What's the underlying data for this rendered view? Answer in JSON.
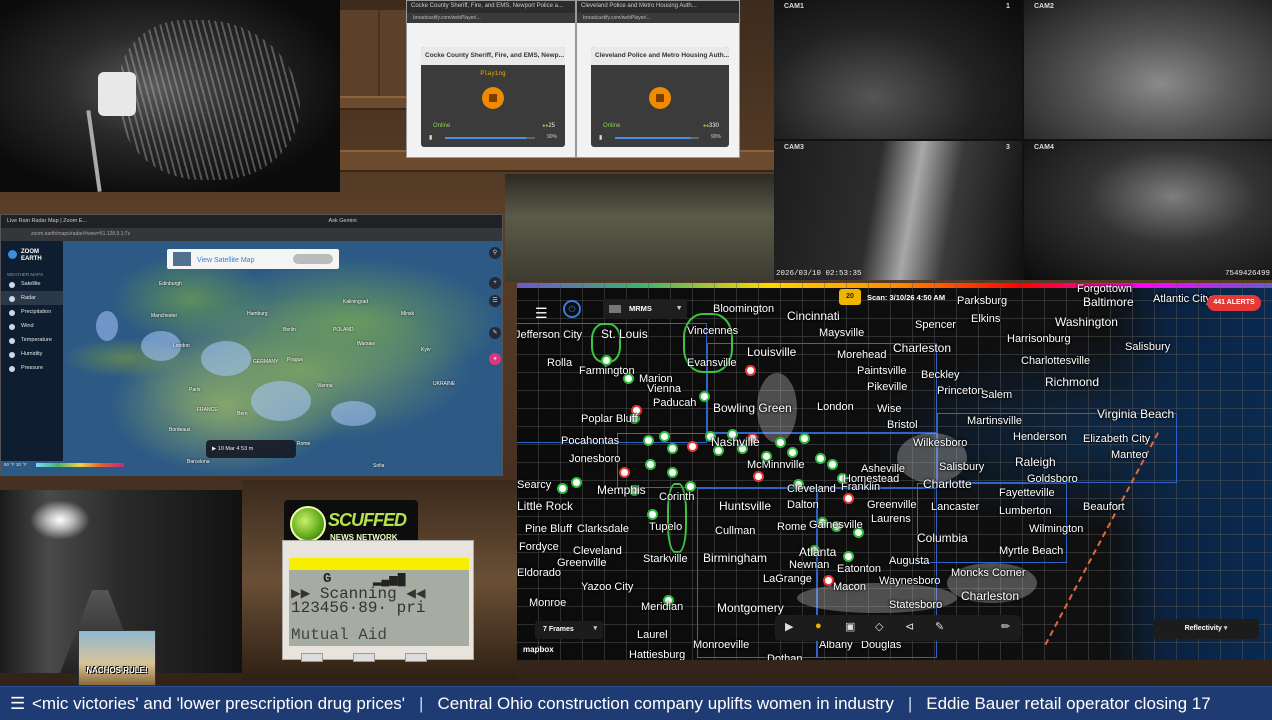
{
  "scanner_windows": [
    {
      "tab_title": "Cocke County Sheriff, Fire, and EMS, Newport Police a...",
      "tab_title_2": "Cleveland Police and Metro Housing Auth...",
      "url": "broadcastify.com/webPlayer/...",
      "feed_title": "Cocke County Sheriff, Fire, and EMS, Newp...",
      "status": "Playing",
      "online_label": "Online",
      "feed_id": "",
      "listeners": "25",
      "volume_pct": "90%",
      "volume_fraction": 0.9
    },
    {
      "tab_title": "Cleveland Police and Metro Housing Auth...",
      "tab_title_2": "",
      "url": "broadcastify.com/webPlayer/...",
      "feed_title": "Cleveland Police and Metro Housing Auth...",
      "status": "",
      "online_label": "Online",
      "feed_id": "",
      "listeners": "330",
      "volume_pct": "90%",
      "volume_fraction": 0.9
    }
  ],
  "security_cams": {
    "labels": [
      "CAM1",
      "CAM2",
      "CAM3",
      "CAM4"
    ],
    "counters": [
      "1",
      "2",
      "3",
      "4"
    ],
    "timestamp": "2026/03/10 02:53:35",
    "serial": "7549426499"
  },
  "zoom_earth": {
    "tab_title": "Live Rain Radar Map | Zoom E...",
    "tab_title_2": "Ask Gemini",
    "url": "zoom.earth/maps/radar/#view=51.128,9.1;7z",
    "logo_line1": "ZOOM",
    "logo_line2": "EARTH",
    "section_label": "WEATHER MAPS",
    "layers": [
      "Satellite",
      "Radar",
      "Precipitation",
      "Wind",
      "Temperature",
      "Humidity",
      "Pressure"
    ],
    "active_layer": "Radar",
    "promo_small": "",
    "promo_text": "View Satellite Map",
    "time_label": "10 Mar",
    "time_hour": "4",
    "time_min": "53 m",
    "scale_label": "50 °F 30 °F",
    "map_labels": [
      "Edinburgh",
      "Manchester",
      "London",
      "Paris",
      "GERMANY",
      "FRANCE",
      "POLAND",
      "UKRAINE",
      "Kaliningrad",
      "Hamburg",
      "Warsaw",
      "Berlin",
      "Prague",
      "Vienna",
      "Rome",
      "Bern",
      "Kyiv",
      "Minsk",
      "Bordeaux",
      "Barcelona",
      "Sofia"
    ]
  },
  "nachos_text": "NACHOS RULE!",
  "scuffed": {
    "title": "SCUFFED",
    "subtitle": "NEWS NETWORK"
  },
  "scanner_lcd": {
    "g_label": "G",
    "signal": "▂▄▆█",
    "line1_left": "▶▶",
    "line1_word": "Scanning",
    "line1_right": "◀◀",
    "line2_digits": "123456·89·",
    "line2_mode": "pri",
    "line3": "Mutual Aid"
  },
  "radar": {
    "product": "MRMS",
    "frame_count": "20",
    "scan_time": "Scan: 3/10/26 4:50 AM",
    "alerts": "441 ALERTS",
    "frames_option": "7 Frames",
    "layer_option": "Reflectivity",
    "attribution": "mapbox",
    "cities": [
      "Bloomington",
      "Cincinnati",
      "Baltimore",
      "Atlantic City",
      "Washington",
      "St. Louis",
      "Vincennes",
      "Maysville",
      "Spencer",
      "Elkins",
      "Jefferson City",
      "Louisville",
      "Charleston",
      "Harrisonburg",
      "Salisbury",
      "Morehead",
      "Charlottesville",
      "Farmington",
      "Evansville",
      "Rolla",
      "Richmond",
      "Paintsville",
      "Pikeville",
      "Beckley",
      "Marion",
      "Vienna",
      "Princeton",
      "Salem",
      "Paducah",
      "London",
      "Wise",
      "Virginia Beach",
      "Poplar Bluff",
      "Bowling Green",
      "Bristol",
      "Martinsville",
      "Henderson",
      "Elizabeth City",
      "Pocahontas",
      "Nashville",
      "Wilkesboro",
      "Manteo",
      "Jonesboro",
      "McMinnville",
      "Asheville",
      "Raleigh",
      "Salisbury",
      "Goldsboro",
      "Memphis",
      "Cleveland",
      "Franklin",
      "Charlotte",
      "Fayetteville",
      "Little Rock",
      "Corinth",
      "Huntsville",
      "Dalton",
      "Greenville",
      "Lancaster",
      "Lumberton",
      "Beaufort",
      "Pine Bluff",
      "Clarksdale",
      "Tupelo",
      "Rome",
      "Gainesville",
      "Laurens",
      "Wilmington",
      "Cullman",
      "Columbia",
      "Fordyce",
      "Cleveland",
      "Atlanta",
      "Myrtle Beach",
      "Greenville",
      "Starkville",
      "Birmingham",
      "Augusta",
      "Eldorado",
      "Newnan",
      "Eatonton",
      "Moncks Corner",
      "Yazoo City",
      "LaGrange",
      "Waynesboro",
      "Charleston",
      "Monroe",
      "Meridian",
      "Montgomery",
      "Macon",
      "Statesboro",
      "Laurel",
      "Albany",
      "Douglas",
      "Monroeville",
      "Hattiesburg",
      "Dothan",
      "Forgottown",
      "Parksburg",
      "Homestead",
      "Searcy"
    ]
  },
  "ticker": {
    "items": [
      "<mic victories' and 'lower prescription drug prices'",
      "Central Ohio construction company uplifts women in industry",
      "Eddie Bauer retail operator closing 17"
    ],
    "separator": "|"
  }
}
